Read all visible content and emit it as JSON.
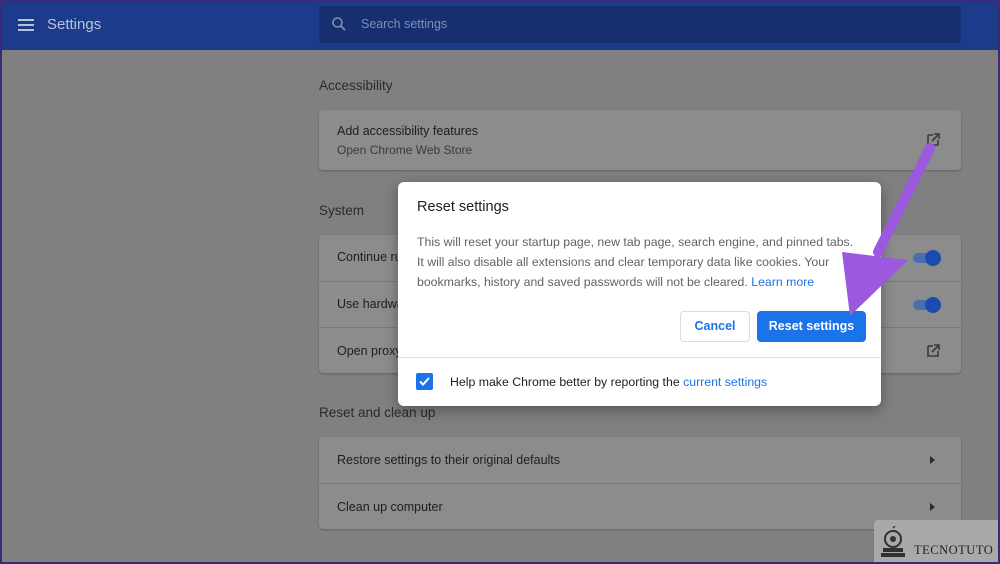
{
  "header": {
    "title": "Settings",
    "search_placeholder": "Search settings"
  },
  "sections": {
    "accessibility": {
      "title": "Accessibility",
      "row_label": "Add accessibility features",
      "row_sub": "Open Chrome Web Store"
    },
    "system": {
      "title": "System",
      "rows": [
        {
          "label": "Continue running background apps when Google Chrome is closed",
          "control": "toggle",
          "on": true
        },
        {
          "label": "Use hardware acceleration when available",
          "control": "toggle",
          "on": true
        },
        {
          "label": "Open proxy settings",
          "control": "external-link-icon"
        }
      ]
    },
    "reset": {
      "title": "Reset and clean up",
      "rows": [
        {
          "label": "Restore settings to their original defaults"
        },
        {
          "label": "Clean up computer"
        }
      ]
    }
  },
  "dialog": {
    "title": "Reset settings",
    "body": "This will reset your startup page, new tab page, search engine, and pinned tabs. It will also disable all extensions and clear temporary data like cookies. Your bookmarks, history and saved passwords will not be cleared.",
    "learn_more": "Learn more",
    "cancel_label": "Cancel",
    "reset_label": "Reset settings",
    "checkbox_checked": true,
    "checkbox_label": "Help make Chrome better by reporting the",
    "checkbox_link": "current settings"
  },
  "watermark": {
    "text": "TECNOTUTO"
  },
  "colors": {
    "topbar": "#1c3b8a",
    "accent": "#1a73e8",
    "annotation_arrow": "#9b59e0"
  }
}
